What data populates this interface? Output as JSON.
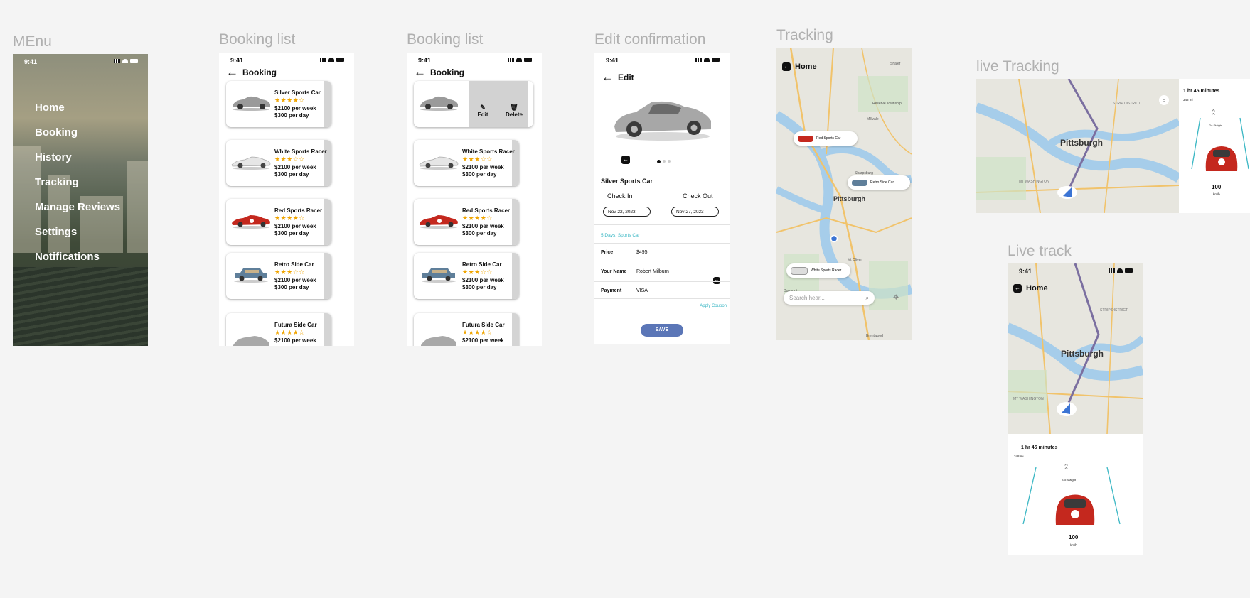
{
  "frames": {
    "menu": "MEnu",
    "booking1": "Booking list",
    "booking2": "Booking list",
    "edit": "Edit confirmation",
    "tracking": "Tracking",
    "live": "live Tracking",
    "livetrack": "Live track"
  },
  "status": {
    "time": "9:41"
  },
  "menu": {
    "items": [
      "Home",
      "Booking",
      "History",
      "Tracking",
      "Manage Reviews",
      "Settings",
      "Notifications"
    ]
  },
  "booking": {
    "title": "Booking",
    "cars": [
      {
        "name": "Silver Sports Car",
        "stars": "★★★★☆",
        "week": "$2100 per week",
        "day": "$300 per day"
      },
      {
        "name": "White Sports Racer",
        "stars": "★★★☆☆",
        "week": "$2100 per week",
        "day": "$300 per day"
      },
      {
        "name": "Red Sports Racer",
        "stars": "★★★★☆",
        "week": "$2100 per week",
        "day": "$300 per day"
      },
      {
        "name": "Retro Side Car",
        "stars": "★★★☆☆",
        "week": "$2100 per week",
        "day": "$300 per day"
      },
      {
        "name": "Futura Side Car",
        "stars": "★★★★☆",
        "week": "$2100 per week",
        "day": ""
      }
    ],
    "edit_label": "Edit",
    "delete_label": "Delete",
    "edit_icon": "pencil-icon",
    "delete_icon": "trash-icon"
  },
  "edit": {
    "title": "Edit",
    "car_name": "Silver Sports Car",
    "check_in_label": "Check In",
    "check_out_label": "Check Out",
    "check_in": "Nov 22, 2023",
    "check_out": "Nov 27, 2023",
    "summary": "5 Days, Sports Car",
    "price_label": "Price",
    "price": "$495",
    "name_label": "Your Name",
    "name": "Robert Milburn",
    "payment_label": "Payment",
    "payment": "VISA",
    "coupon": "Apply Coupon",
    "save": "SAVE"
  },
  "tracking": {
    "home": "Home",
    "city": "Pittsburgh",
    "pills": [
      "Red Sports Car",
      "Retro Side Car",
      "White Sports Racer"
    ],
    "search_placeholder": "Search hear...",
    "map_labels": [
      "Reserve Township",
      "Millvale",
      "Shaler",
      "Sharpsburg",
      "Mt Oliver",
      "Dormont",
      "Brentwood"
    ]
  },
  "live": {
    "duration": "1 hr 45 minutes",
    "distance": "348 mi",
    "instruction": "Go Staight",
    "speed": "100",
    "unit": "km/h",
    "city": "Pittsburgh",
    "labels": [
      "STRIP DISTRICT",
      "MT WASHINGTON"
    ],
    "home": "Home"
  },
  "colors": {
    "accent": "#5b76b7",
    "star": "#f0a500",
    "route": "#7b6fa0",
    "teal": "#3bb7c4"
  }
}
